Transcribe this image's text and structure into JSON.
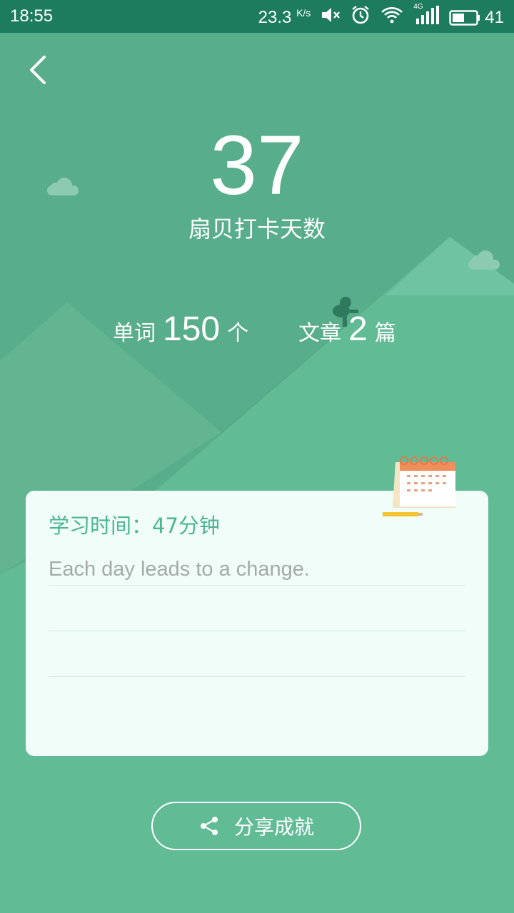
{
  "statusbar": {
    "time": "18:55",
    "speed": "23.3",
    "speed_unit": "K/s",
    "network": "4G",
    "battery": "41"
  },
  "summary": {
    "days": "37",
    "days_label": "扇贝打卡天数",
    "words_label": "单词",
    "words_count": "150",
    "words_unit": "个",
    "articles_label": "文章",
    "articles_count": "2",
    "articles_unit": "篇"
  },
  "card": {
    "study_time": "学习时间：47分钟",
    "quote": "Each day leads to a change."
  },
  "share": {
    "label": "分享成就"
  },
  "colors": {
    "background": "#58ad8a",
    "statusbar": "#1e7c5e",
    "card": "#f0fdf8",
    "accent": "#4cb593"
  }
}
